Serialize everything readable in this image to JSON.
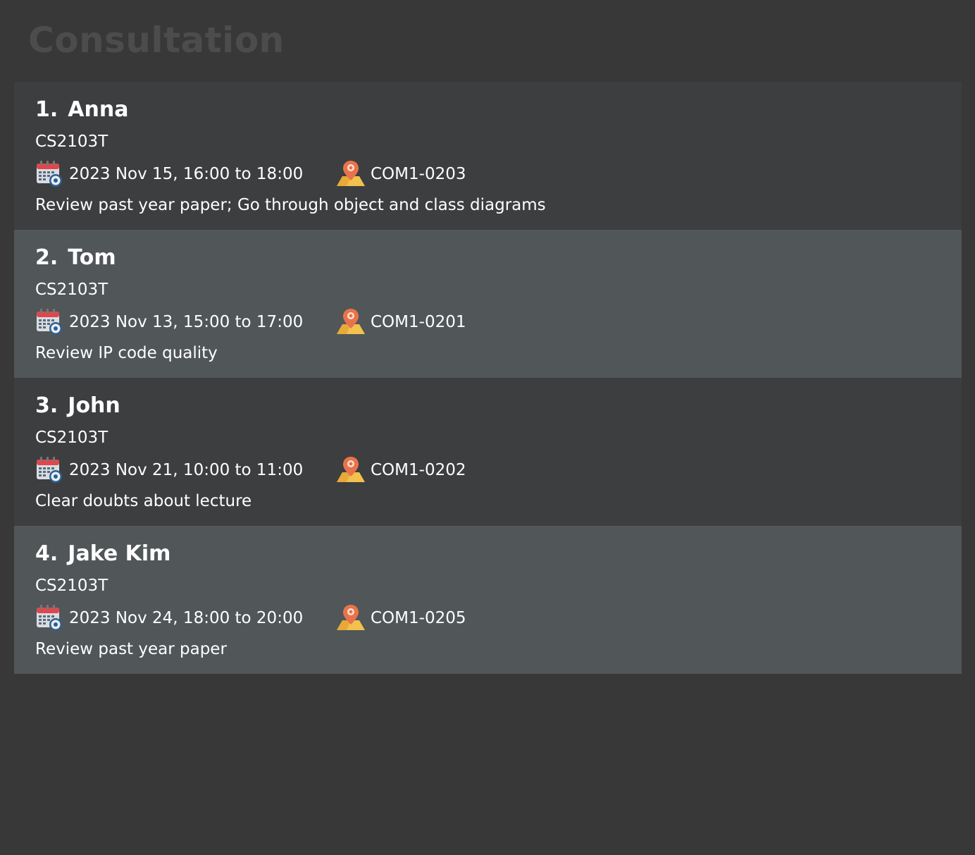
{
  "header": {
    "title": "Consultation"
  },
  "consultations": [
    {
      "index": "1.",
      "name": "Anna",
      "module": "CS2103T",
      "time": "2023 Nov 15, 16:00 to 18:00",
      "location": "COM1-0203",
      "description": "Review past year paper; Go through object and class diagrams"
    },
    {
      "index": "2.",
      "name": "Tom",
      "module": "CS2103T",
      "time": "2023 Nov 13, 15:00 to 17:00",
      "location": "COM1-0201",
      "description": "Review IP code quality"
    },
    {
      "index": "3.",
      "name": "John",
      "module": "CS2103T",
      "time": "2023 Nov 21, 10:00 to 11:00",
      "location": "COM1-0202",
      "description": "Clear doubts about lecture"
    },
    {
      "index": "4.",
      "name": "Jake Kim",
      "module": "CS2103T",
      "time": "2023 Nov 24, 18:00 to 20:00",
      "location": "COM1-0205",
      "description": "Review past year paper"
    }
  ],
  "icons": {
    "time": "calendar-clock-icon",
    "location": "map-pin-icon"
  },
  "colors": {
    "background": "#383838",
    "header_text": "#4c4c4c",
    "card_odd": "#3c3e3f",
    "card_even": "#515658",
    "text": "#ffffff",
    "calendar_red": "#e0474c",
    "pin_orange": "#e8734a",
    "map_yellow": "#f2c14e"
  }
}
